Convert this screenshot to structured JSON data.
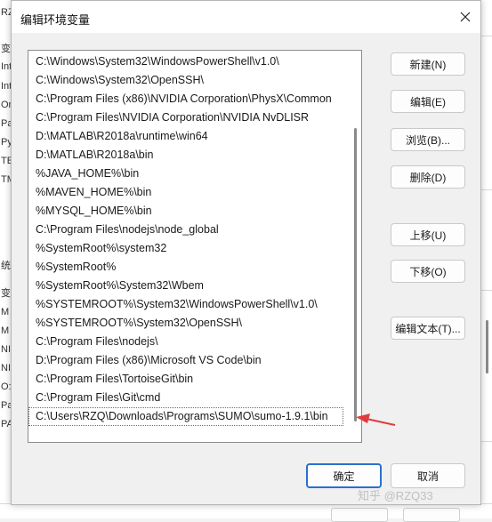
{
  "background": {
    "left_fragments": [
      "RZQ",
      "变",
      "Int",
      "Int",
      "On",
      "Pa",
      "Py",
      "TE",
      "TM",
      "统",
      "变",
      "M",
      "M",
      "NI",
      "NI",
      "O:",
      "Pa",
      "PA"
    ]
  },
  "dialog": {
    "title": "编辑环境变量",
    "paths": [
      "C:\\Windows\\System32\\WindowsPowerShell\\v1.0\\",
      "C:\\Windows\\System32\\OpenSSH\\",
      "C:\\Program Files (x86)\\NVIDIA Corporation\\PhysX\\Common",
      "C:\\Program Files\\NVIDIA Corporation\\NVIDIA NvDLISR",
      "D:\\MATLAB\\R2018a\\runtime\\win64",
      "D:\\MATLAB\\R2018a\\bin",
      "%JAVA_HOME%\\bin",
      "%MAVEN_HOME%\\bin",
      "%MYSQL_HOME%\\bin",
      "C:\\Program Files\\nodejs\\node_global",
      "%SystemRoot%\\system32",
      "%SystemRoot%",
      "%SystemRoot%\\System32\\Wbem",
      "%SYSTEMROOT%\\System32\\WindowsPowerShell\\v1.0\\",
      "%SYSTEMROOT%\\System32\\OpenSSH\\",
      "C:\\Program Files\\nodejs\\",
      "D:\\Program Files (x86)\\Microsoft VS Code\\bin",
      "C:\\Program Files\\TortoiseGit\\bin",
      "C:\\Program Files\\Git\\cmd",
      "C:\\Users\\RZQ\\Downloads\\Programs\\SUMO\\sumo-1.9.1\\bin"
    ],
    "buttons": {
      "new": "新建(N)",
      "edit": "编辑(E)",
      "browse": "浏览(B)...",
      "delete": "删除(D)",
      "move_up": "上移(U)",
      "move_down": "下移(O)",
      "edit_text": "编辑文本(T)...",
      "ok": "确定",
      "cancel": "取消"
    }
  },
  "watermark": "知乎 @RZQ33",
  "colors": {
    "annotation_arrow": "#e03b3b",
    "default_button_border": "#2a6fcf"
  }
}
